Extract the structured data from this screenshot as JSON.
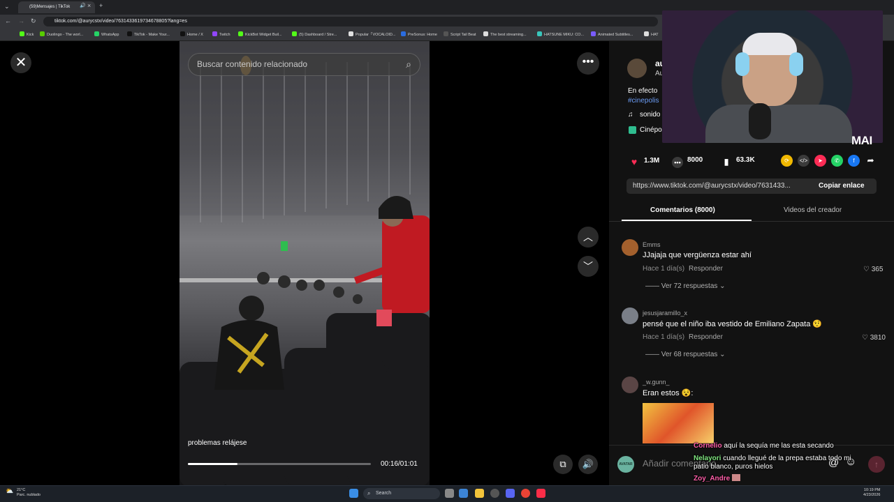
{
  "browser": {
    "tab_title": "(59)Mensajes | TikTok",
    "url": "tiktok.com/@aurycstx/video/7631433619734678805?lang=es",
    "bookmarks": [
      {
        "label": "Kick",
        "color": "#53fc18"
      },
      {
        "label": "Duolingo - The worl...",
        "color": "#58cc02"
      },
      {
        "label": "WhatsApp",
        "color": "#25d366"
      },
      {
        "label": "TikTok - Make Your...",
        "color": "#111111"
      },
      {
        "label": "Home / X",
        "color": "#111111"
      },
      {
        "label": "Twitch",
        "color": "#9146ff"
      },
      {
        "label": "KickBot Widget Buil...",
        "color": "#53fc18"
      },
      {
        "label": "(5) Dashboard / Stre...",
        "color": "#53fc18"
      },
      {
        "label": "Popular「VOCALOID...",
        "color": "#e0e0e0"
      },
      {
        "label": "PreSonus: Home",
        "color": "#2a6cdf"
      },
      {
        "label": "Script Tail Beat",
        "color": "#555555"
      },
      {
        "label": "The best streaming...",
        "color": "#dddddd"
      },
      {
        "label": "HATSUNE MIKU: CO...",
        "color": "#39c5bb"
      },
      {
        "label": "Animated Subtitles...",
        "color": "#7a5cff"
      },
      {
        "label": "HAT",
        "color": "#dddddd"
      }
    ]
  },
  "video": {
    "search_placeholder": "Buscar contenido relacionado",
    "caption_text": "problemas relájese",
    "time": "00:16/01:01",
    "progress": 0.27
  },
  "post": {
    "description_start": "En efecto",
    "hashtag": "#cinepolis",
    "sound_label": "sonido",
    "location": "Cinépo",
    "creator_initial": "au",
    "creator_sub": "Au"
  },
  "stats": {
    "likes": "1.3M",
    "comments": "8000",
    "saves": "63.3K"
  },
  "link": {
    "url": "https://www.tiktok.com/@aurycstx/video/7631433...",
    "copy_label": "Copiar enlace"
  },
  "tabs": {
    "comments": "Comentarios (8000)",
    "creator_videos": "Videos del creador"
  },
  "comments": [
    {
      "user": "Emms",
      "text": "JJajaja que vergüenza estar ahí",
      "time": "Hace 1 día(s)",
      "reply": "Responder",
      "likes": "365",
      "more": "Ver 72 respuestas",
      "avatar_color": "#a3602d"
    },
    {
      "user": "jesusjaramillo_x",
      "text": "pensé que el niño iba vestido de Emiliano Zapata 🤨",
      "time": "Hace 1 día(s)",
      "reply": "Responder",
      "likes": "3810",
      "more": "Ver 68 respuestas",
      "avatar_color": "#7a7f88"
    },
    {
      "user": "_w.gunn_",
      "text": "Eran estos 😵:",
      "avatar_color": "#5a4545"
    }
  ],
  "comment_input": {
    "placeholder": "Añadir comentario..."
  },
  "stream_chat": [
    {
      "user": "Cornelio",
      "msg": "aquí la sequía me las esta secando",
      "color": "#ff5ea8"
    },
    {
      "user": "Nelayori",
      "msg": "cuando llegué de la prepa estaba todo mi patio blanco, puros hielos",
      "color": "#7fe57f"
    },
    {
      "user": "Zoy_Andre",
      "msg": "",
      "color": "#ff5ea8"
    }
  ],
  "webcam": {
    "logo": "MAI"
  },
  "taskbar": {
    "weather_temp": "21°C",
    "weather_desc": "Parc. nublado",
    "search": "Search",
    "time": "10:19 PM",
    "date": "4/23/2026"
  }
}
